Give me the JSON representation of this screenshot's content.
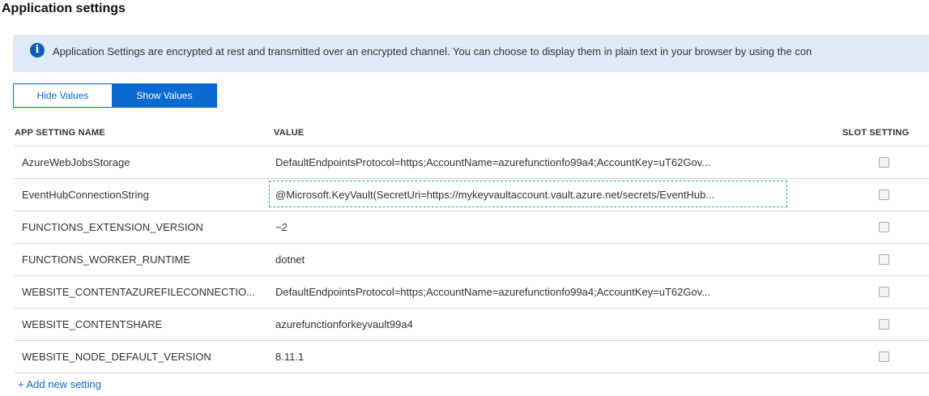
{
  "page": {
    "title": "Application settings"
  },
  "banner": {
    "icon": "info-icon",
    "text": "Application Settings are encrypted at rest and transmitted over an encrypted channel. You can choose to display them in plain text in your browser by using the con"
  },
  "toggle": {
    "hide_label": "Hide Values",
    "show_label": "Show Values",
    "selected": "Show Values"
  },
  "table": {
    "headers": {
      "name": "APP SETTING NAME",
      "value": "VALUE",
      "slot": "SLOT SETTING"
    },
    "rows": [
      {
        "name": "AzureWebJobsStorage",
        "value": "DefaultEndpointsProtocol=https;AccountName=azurefunctionfo99a4;AccountKey=uT62Gov..."
      },
      {
        "name": "EventHubConnectionString",
        "value": "@Microsoft.KeyVault(SecretUri=https://mykeyvaultaccount.vault.azure.net/secrets/EventHub..."
      },
      {
        "name": "FUNCTIONS_EXTENSION_VERSION",
        "value": "~2"
      },
      {
        "name": "FUNCTIONS_WORKER_RUNTIME",
        "value": "dotnet"
      },
      {
        "name": "WEBSITE_CONTENTAZUREFILECONNECTIO...",
        "value": "DefaultEndpointsProtocol=https;AccountName=azurefunctionfo99a4;AccountKey=uT62Gov..."
      },
      {
        "name": "WEBSITE_CONTENTSHARE",
        "value": "azurefunctionforkeyvault99a4"
      },
      {
        "name": "WEBSITE_NODE_DEFAULT_VERSION",
        "value": "8.11.1"
      }
    ]
  },
  "add_setting_label": "+ Add new setting",
  "colors": {
    "accent": "#0a6ad0",
    "banner_bg": "#dfeaf7",
    "info_icon": "#0a5eb8"
  }
}
